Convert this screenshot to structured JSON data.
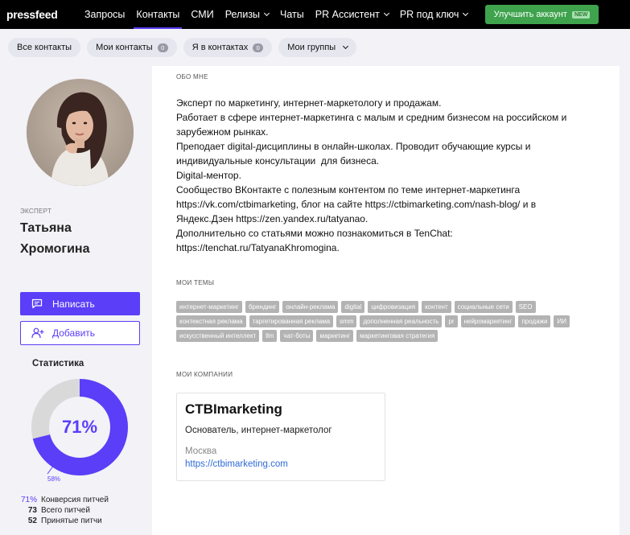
{
  "nav": {
    "logo": "pressfeed",
    "items": [
      {
        "label": "Запросы"
      },
      {
        "label": "Контакты"
      },
      {
        "label": "СМИ"
      },
      {
        "label": "Релизы"
      },
      {
        "label": "Чаты"
      },
      {
        "label": "PR Ассистент"
      },
      {
        "label": "PR под ключ"
      }
    ],
    "upgrade": {
      "label": "Улучшить аккаунт",
      "badge": "NEW"
    }
  },
  "subtabs": [
    {
      "label": "Все контакты"
    },
    {
      "label": "Мои контакты",
      "count": "0"
    },
    {
      "label": "Я в контактах",
      "count": "0"
    },
    {
      "label": "Мои группы"
    }
  ],
  "profile": {
    "role": "ЭКСПЕРТ",
    "name_first": "Татьяна",
    "name_last": "Хромогина",
    "write_label": "Написать",
    "add_label": "Добавить"
  },
  "stats": {
    "title": "Статистика",
    "conversion_pct": 71,
    "center_label": "71%",
    "small_label": "58%",
    "rows": [
      {
        "value": "71%",
        "label": "Конверсия питчей"
      },
      {
        "value": "73",
        "label": "Всего питчей"
      },
      {
        "value": "52",
        "label": "Принятые питчи"
      }
    ]
  },
  "about": {
    "heading": "ОБО МНЕ",
    "lines": [
      "Эксперт по маркетингу, интернет-маркетологу и продажам.",
      "Работает в сфере интернет-маркетинга с малым и средним бизнесом на российском и зарубежном рынках.",
      "Преподает digital-дисциплины в онлайн-школах. Проводит обучающие курсы и индивидуальные консультации  для бизнеса.",
      "Digital-ментор.",
      "Сообщество ВКонтакте с полезным контентом по теме интернет-маркетинга https://vk.com/ctbimarketing, блог на сайте https://ctbimarketing.com/nash-blog/ и в Яндекс.Дзен https://zen.yandex.ru/tatyanao.",
      "Дополнительно со статьями можно познакомиться в TenChat: https://tenchat.ru/TatyanaKhromogina."
    ]
  },
  "topics": {
    "heading": "МОИ ТЕМЫ",
    "tags": [
      "интернет-маркетинг",
      "брендинг",
      "онлайн-реклама",
      "digital",
      "цифровизация",
      "контент",
      "социальные сети",
      "SEO",
      "контекстная реклама",
      "таргетированная реклама",
      "smm",
      "дополненная реальность",
      "pr",
      "нейромаркетинг",
      "продажи",
      "ИИ",
      "искусственный интеллект",
      "llm",
      "чат-боты",
      "маркетинг",
      "маркетинговая стратегия"
    ]
  },
  "companies": {
    "heading": "МОИ КОМПАНИИ",
    "items": [
      {
        "name": "CTBImarketing",
        "role": "Основатель, интернет-маркетолог",
        "city": "Москва",
        "url": "https://ctbimarketing.com"
      }
    ]
  },
  "colors": {
    "accent": "#5a3ef8",
    "donut_rest": "#d9d9d9",
    "upgrade": "#3fa34d"
  }
}
